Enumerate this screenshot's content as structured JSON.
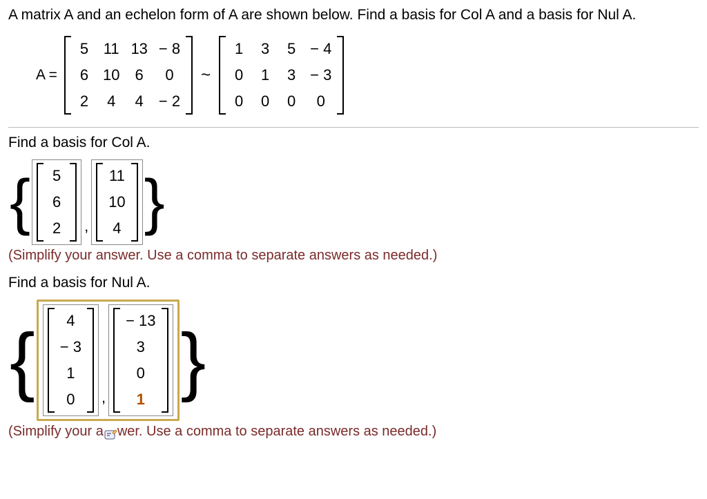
{
  "question": "A matrix A and an echelon form of A are shown below. Find a basis for Col A and a basis for Nul A.",
  "eq_label": "A =",
  "tilde": "~",
  "A": [
    [
      "5",
      "11",
      "13",
      "− 8"
    ],
    [
      "6",
      "10",
      "6",
      "0"
    ],
    [
      "2",
      "4",
      "4",
      "− 2"
    ]
  ],
  "E": [
    [
      "1",
      "3",
      "5",
      "− 4"
    ],
    [
      "0",
      "1",
      "3",
      "− 3"
    ],
    [
      "0",
      "0",
      "0",
      "0"
    ]
  ],
  "colA_prompt": "Find a basis for Col A.",
  "colA_v1": [
    "5",
    "6",
    "2"
  ],
  "colA_v2": [
    "11",
    "10",
    "4"
  ],
  "hint": "(Simplify your answer. Use a comma to separate answers as needed.)",
  "nulA_prompt": "Find a basis for Nul A.",
  "nulA_v1": [
    "4",
    "− 3",
    "1",
    "0"
  ],
  "nulA_v2": [
    "− 13",
    "3",
    "0",
    "1"
  ],
  "hint2_a": "(Simplify your a",
  "hint2_b": "wer. Use a comma to separate answers as needed.)",
  "sep": ","
}
